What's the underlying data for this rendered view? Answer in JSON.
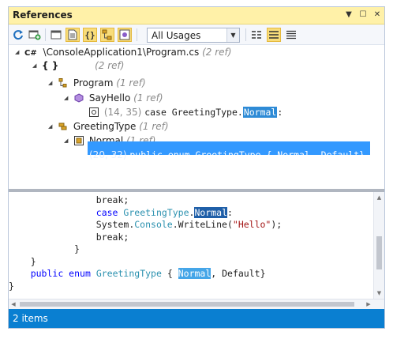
{
  "window": {
    "title": "References"
  },
  "title_buttons": [
    {
      "name": "dropdown-arrow-icon",
      "glyph": "▼"
    },
    {
      "name": "maximize-icon",
      "glyph": "☐"
    },
    {
      "name": "close-icon",
      "glyph": "✕"
    }
  ],
  "toolbar": {
    "buttons": [
      {
        "name": "refresh-icon"
      },
      {
        "name": "add-window-icon"
      },
      {
        "name": "window-icon"
      },
      {
        "name": "document-icon",
        "active": true
      },
      {
        "name": "braces-icon",
        "active": true
      },
      {
        "name": "hierarchy-icon",
        "active": true
      },
      {
        "name": "class-icon",
        "active": true
      }
    ],
    "scope": {
      "selected": "All Usages"
    },
    "view_buttons": [
      {
        "name": "compact-view-icon"
      },
      {
        "name": "detailed-view-icon",
        "active": true
      },
      {
        "name": "list-view-icon"
      }
    ]
  },
  "tree": {
    "file": {
      "lang_badge": "C#",
      "path": "\\ConsoleApplication1\\Program.cs",
      "refs": "(2 ref)"
    },
    "namespace": {
      "label": "{ }",
      "refs": "(2 ref)"
    },
    "class_program": {
      "label": "Program",
      "refs": "(1 ref)"
    },
    "method_sayhello": {
      "label": "SayHello",
      "refs": "(1 ref)"
    },
    "usage1": {
      "pos": "(14, 35)",
      "code_before": "case GreetingType.",
      "highlight": "Normal",
      "code_after": ":"
    },
    "enum_greetingtype": {
      "label": "GreetingType",
      "refs": "(1 ref)"
    },
    "enum_member": {
      "label": "Normal",
      "refs": "(1 ref)"
    },
    "usage2": {
      "pos": "(20, 32)",
      "code": "public enum GreetingType { Normal, Default}"
    }
  },
  "code": {
    "l1": "break;",
    "l2_kw": "case",
    "l2_type": "GreetingType",
    "l2_dot": ".",
    "l2_hl": "Normal",
    "l2_colon": ":",
    "l3_pre": "System.",
    "l3_type": "Console",
    "l3_mid": ".WriteLine(",
    "l3_str": "\"Hello\"",
    "l3_end": ");",
    "l4": "break;",
    "l5": "}",
    "l6": "}",
    "l7_kw": "public enum",
    "l7_type": "GreetingType",
    "l7_open": "{",
    "l7_hl": "Normal",
    "l7_rest": ", Default}",
    "l8": "}"
  },
  "status": {
    "text": "2 items"
  },
  "colors": {
    "title_bg": "#fff1a8",
    "status_bg": "#0a7fd1",
    "selection": "#3399ff"
  }
}
